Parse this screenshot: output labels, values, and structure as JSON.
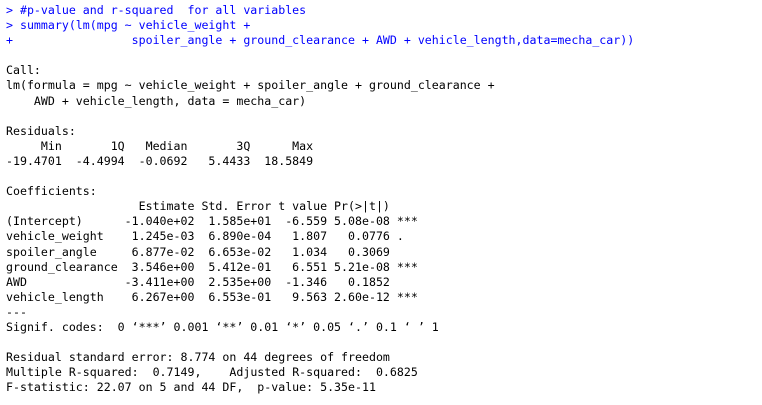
{
  "colors": {
    "background": "#ffffff",
    "command": "#0000ff",
    "output": "#000000"
  },
  "console": {
    "commands": [
      "> #p-value and r-squared  for all variables",
      "> summary(lm(mpg ~ vehicle_weight +",
      "+                 spoiler_angle + ground_clearance + AWD + vehicle_length,data=mecha_car))"
    ],
    "call_header": "Call:",
    "call_lines": [
      "lm(formula = mpg ~ vehicle_weight + spoiler_angle + ground_clearance + ",
      "    AWD + vehicle_length, data = mecha_car)"
    ],
    "residuals_header": "Residuals:",
    "residuals_lines": [
      "     Min       1Q   Median       3Q      Max ",
      "-19.4701  -4.4994  -0.0692   5.4433  18.5849 "
    ],
    "coefficients_header": "Coefficients:",
    "coefficients_lines": [
      "                   Estimate Std. Error t value Pr(>|t|)    ",
      "(Intercept)      -1.040e+02  1.585e+01  -6.559 5.08e-08 ***",
      "vehicle_weight    1.245e-03  6.890e-04   1.807   0.0776 .  ",
      "spoiler_angle     6.877e-02  6.653e-02   1.034   0.3069    ",
      "ground_clearance  3.546e+00  5.412e-01   6.551 5.21e-08 ***",
      "AWD              -3.411e+00  2.535e+00  -1.346   0.1852    ",
      "vehicle_length    6.267e+00  6.553e-01   9.563 2.60e-12 ***"
    ],
    "separator": "---",
    "signif_codes": "Signif. codes:  0 ‘***’ 0.001 ‘**’ 0.01 ‘*’ 0.05 ‘.’ 0.1 ‘ ’ 1",
    "summary_lines": [
      "Residual standard error: 8.774 on 44 degrees of freedom",
      "Multiple R-squared:  0.7149,\tAdjusted R-squared:  0.6825 ",
      "F-statistic: 22.07 on 5 and 44 DF,  p-value: 5.35e-11"
    ]
  }
}
